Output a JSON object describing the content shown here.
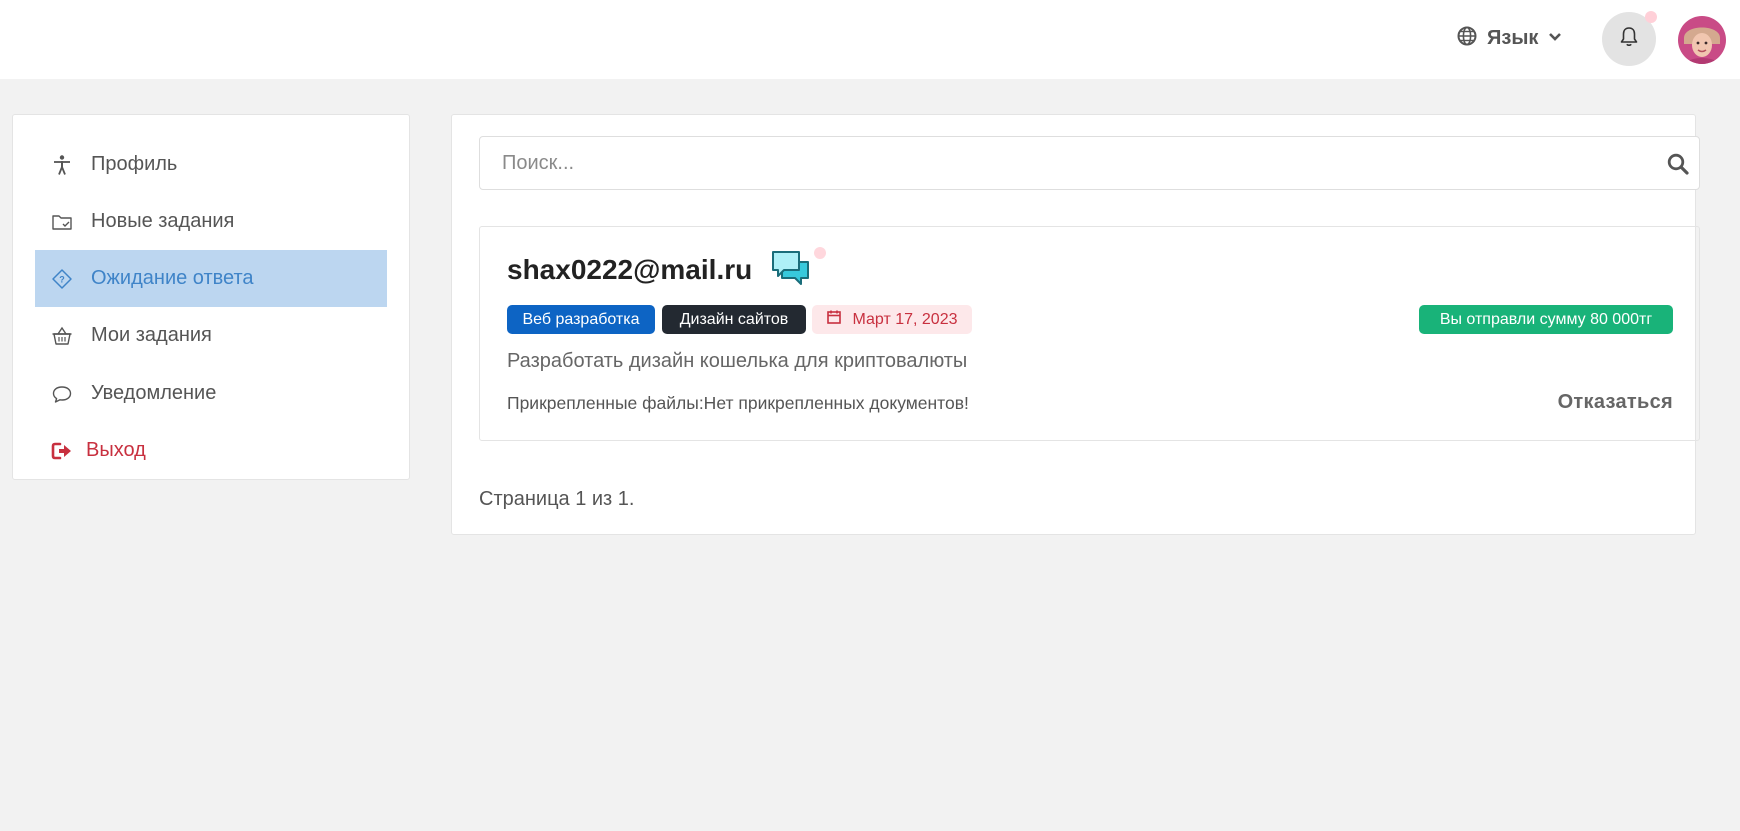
{
  "header": {
    "language_label": "Язык",
    "icons": [
      "globe-icon",
      "chevron-down-icon",
      "bell-icon",
      "avatar"
    ]
  },
  "sidebar": {
    "items": [
      {
        "label": "Профиль",
        "icon": "person-icon"
      },
      {
        "label": "Новые задания",
        "icon": "folder-icon"
      },
      {
        "label": "Ожидание ответа",
        "icon": "tag-icon",
        "active": true
      },
      {
        "label": "Мои задания",
        "icon": "basket-icon"
      },
      {
        "label": "Уведомление",
        "icon": "chat-bubble-icon"
      },
      {
        "label": "Выход",
        "icon": "logout-icon"
      }
    ]
  },
  "search": {
    "placeholder": "Поиск...",
    "value": ""
  },
  "task": {
    "email": "shax0222@mail.ru",
    "tags": [
      "Веб разработка",
      "Дизайн сайтов"
    ],
    "date": "Март 17, 2023",
    "sent_badge": "Вы отправли сумму 80 000тг",
    "description": "Разработать дизайн кошелька для криптовалюты",
    "files_text": "Прикрепленные файлы:Нет прикрепленных документов!",
    "refuse_label": "Отказаться"
  },
  "pagination": {
    "text": "Страница 1 из 1."
  },
  "colors": {
    "active_bg": "#bcd6f0",
    "active_text": "#3f84c8",
    "logout": "#c8303f",
    "tag_web": "#0d64c4",
    "tag_design": "#232931",
    "badge_sent": "#19b379",
    "chat_icon": "#38c9dc"
  }
}
